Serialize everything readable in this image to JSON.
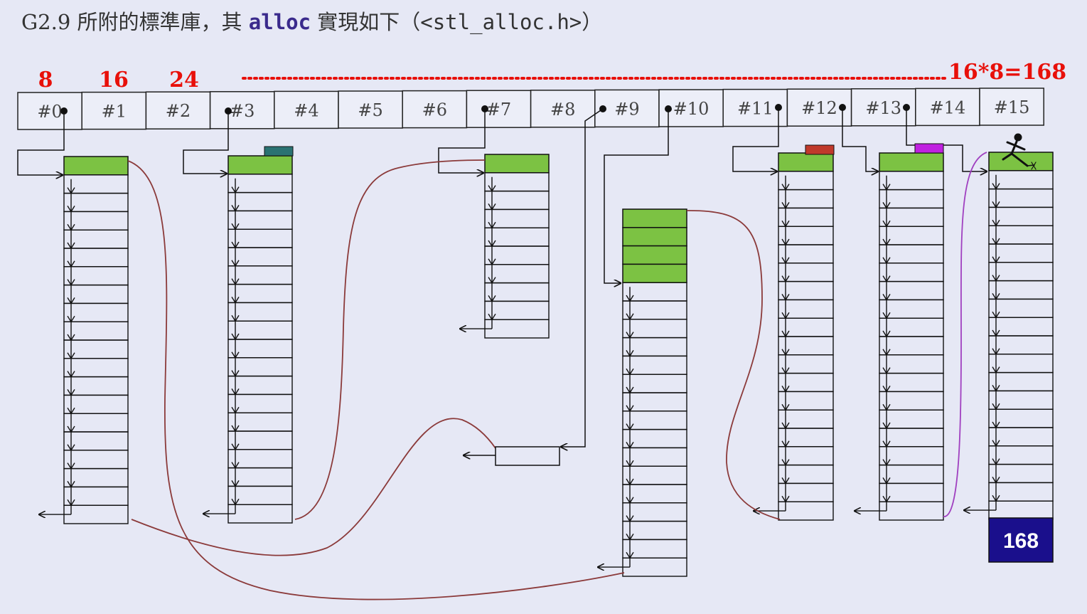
{
  "title": {
    "prefix": "G2.9 所附的標準庫，其 ",
    "code": "alloc",
    "middle": " 實現如下（",
    "header_file": "<stl_alloc.h>",
    "suffix": "）"
  },
  "size_labels": [
    "8",
    "16",
    "24"
  ],
  "formula": "16*8=168",
  "free_list_slots": [
    "#0",
    "#1",
    "#2",
    "#3",
    "#4",
    "#5",
    "#6",
    "#7",
    "#8",
    "#9",
    "#10",
    "#11",
    "#12",
    "#13",
    "#14",
    "#15"
  ],
  "total_badge": "168",
  "colors": {
    "accent_red": "#e8100a",
    "chunk_green": "#7cc243",
    "link_curve": "#8b3a3a",
    "badge_bg": "#1a0f8c",
    "teal_block": "#2a7272",
    "red_block": "#c0392b",
    "magenta_block": "#c020e0",
    "purple_curve": "#a040c0"
  },
  "icons": [
    "hurdler-icon"
  ]
}
